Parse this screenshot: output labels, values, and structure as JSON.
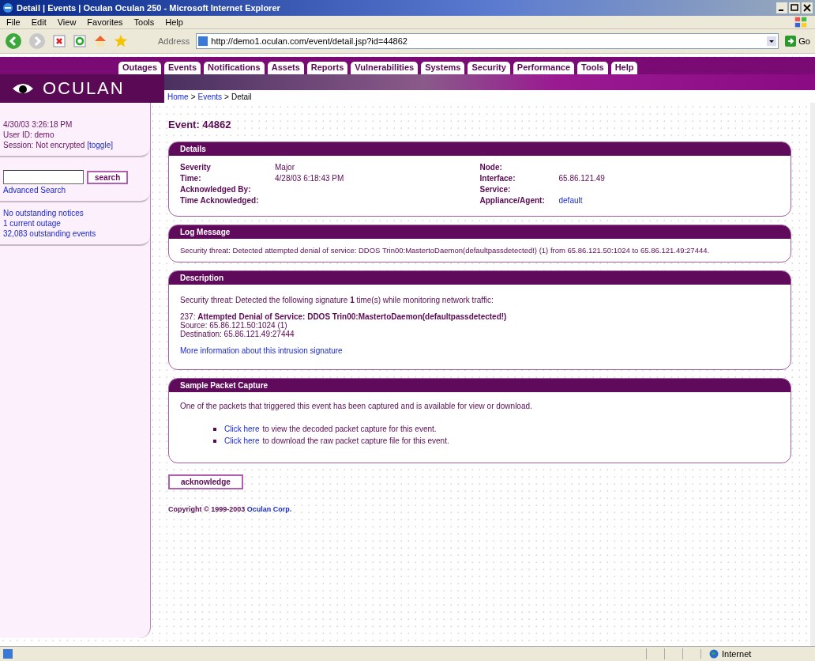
{
  "window": {
    "title": "Detail | Events | Oculan Oculan 250 - Microsoft Internet Explorer"
  },
  "menu": [
    "File",
    "Edit",
    "View",
    "Favorites",
    "Tools",
    "Help"
  ],
  "address_bar": {
    "label": "Address",
    "url": "http://demo1.oculan.com/event/detail.jsp?id=44862",
    "go": "Go"
  },
  "nav_tabs": [
    "Outages",
    "Events",
    "Notifications",
    "Assets",
    "Reports",
    "Vulnerabilities",
    "Systems",
    "Security",
    "Performance",
    "Tools",
    "Help"
  ],
  "logo": {
    "text": "OCULAN"
  },
  "breadcrumb": {
    "separator": ">",
    "items": [
      {
        "label": "Home",
        "kind": "link"
      },
      {
        "label": "Events",
        "kind": "link"
      },
      {
        "label": "Detail",
        "kind": "current"
      }
    ]
  },
  "sidebar": {
    "timestamp": "4/30/03 3:26:18 PM",
    "user": "User ID: demo",
    "session": "Session: Not encrypted",
    "session_toggle": "[toggle]",
    "search_button": "search",
    "advanced_search": "Advanced Search",
    "notices": [
      "No outstanding notices",
      "1 current outage",
      "32,083 outstanding events"
    ]
  },
  "event_title": "Event: 44862",
  "details": {
    "title": "Details",
    "left": [
      {
        "label": "Severity",
        "value": "Major",
        "kind": "text"
      },
      {
        "label": "Time:",
        "value": "4/28/03 6:18:43 PM",
        "kind": "text"
      },
      {
        "label": "Acknowledged By:"
      },
      {
        "label": "Time Acknowledged:"
      }
    ],
    "right": [
      {
        "label": "Node:"
      },
      {
        "label": "Interface:",
        "value": "65.86.121.49",
        "kind": "text"
      },
      {
        "label": "Service:"
      },
      {
        "label": "Appliance/Agent:",
        "value": "default",
        "kind": "link"
      }
    ]
  },
  "log_message": {
    "title": "Log Message",
    "text": "Security threat: Detected attempted denial of service: DDOS Trin00:MastertoDaemon(defaultpassdetected!) (1) from 65.86.121.50:1024 to 65.86.121.49:27444."
  },
  "description": {
    "title": "Description",
    "intro": "Security threat: Detected the following signature **1** time(s) while monitoring network traffic:",
    "signature": "237: **Attempted Denial of Service: DDOS Trin00:MastertoDaemon(defaultpassdetected!)**",
    "source": "Source: 65.86.121.50:1024 (1)",
    "destination": "Destination: 65.86.121.49:27444",
    "more_link": "More information about this intrusion signature"
  },
  "packet_capture": {
    "title": "Sample Packet Capture",
    "text": "One of the packets that triggered this event has been captured and is available for view or download.",
    "items": [
      {
        "link": "Click here",
        "text": "to view the decoded packet capture for this event."
      },
      {
        "link": "Click here",
        "text": "to download the raw packet capture file for this event."
      }
    ]
  },
  "acknowledge_button": "acknowledge",
  "footer": {
    "text": "Copyright © 1999-2003",
    "link": "Oculan Corp."
  },
  "status_bar": {
    "zone": "Internet"
  }
}
